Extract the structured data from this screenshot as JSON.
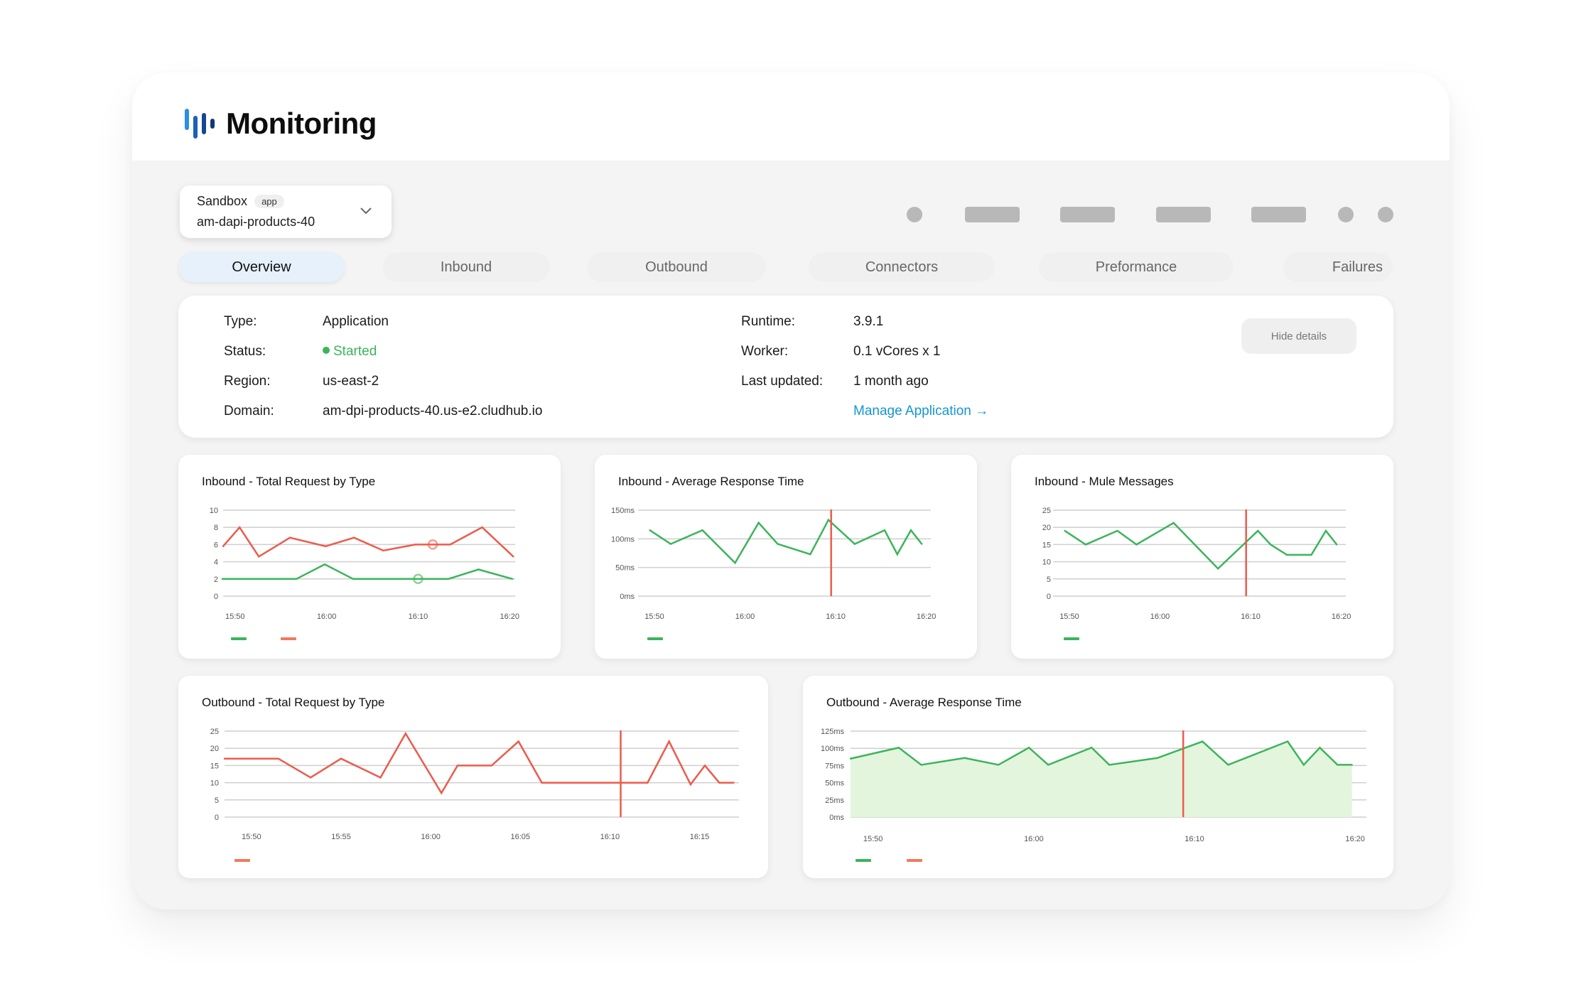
{
  "app": {
    "title": "Monitoring",
    "logo_icon": "bar-chart-logo-icon"
  },
  "selector": {
    "environment": "Sandbox",
    "badge": "app",
    "application": "am-dapi-products-40",
    "icon": "chevron-down-icon"
  },
  "tabs": [
    {
      "label": "Overview",
      "active": true
    },
    {
      "label": "Inbound",
      "active": false
    },
    {
      "label": "Outbound",
      "active": false
    },
    {
      "label": "Connectors",
      "active": false
    },
    {
      "label": "Preformance",
      "active": false
    },
    {
      "label": "Failures",
      "active": false
    }
  ],
  "details": {
    "left": [
      {
        "label": "Type:",
        "value": "Application"
      },
      {
        "label": "Status:",
        "value": "Started"
      },
      {
        "label": "Region:",
        "value": "us-east-2"
      },
      {
        "label": "Domain:",
        "value": "am-dpi-products-40.us-e2.cludhub.io"
      }
    ],
    "right": [
      {
        "label": "Runtime:",
        "value": "3.9.1"
      },
      {
        "label": "Worker:",
        "value": "0.1 vCores x 1"
      },
      {
        "label": "Last updated:",
        "value": "1 month ago"
      }
    ],
    "manage_link": "Manage Application →",
    "hide_button": "Hide details",
    "status_color": "#3cb45a"
  },
  "colors": {
    "green": "#3cb45a",
    "red": "#ec5b4c",
    "green_fill": "#e3f5dd",
    "grid": "#cfcfcf",
    "link": "#1596d2"
  },
  "chart_data": [
    {
      "id": "inbound-total",
      "type": "line",
      "title": "Inbound - Total Request by Type",
      "ylim": [
        0,
        10
      ],
      "yticks": [
        0,
        2,
        4,
        6,
        8,
        10
      ],
      "ytick_labels": [
        "0",
        "2",
        "4",
        "6",
        "8",
        "10"
      ],
      "xlim": [
        -1.3,
        30.6
      ],
      "xticks": [
        0,
        10,
        20,
        30
      ],
      "xtick_labels": [
        "15:50",
        "16:00",
        "16:10",
        "16:20"
      ],
      "series": [
        {
          "name": "",
          "color": "green",
          "x": [
            -1.4,
            6.7,
            9.8,
            12.9,
            20,
            23.3,
            26.6,
            30.3
          ],
          "y": [
            2,
            2,
            3.7,
            2,
            2,
            2,
            3.1,
            2
          ],
          "marker_at": 20
        },
        {
          "name": "",
          "color": "red",
          "x": [
            -1.3,
            0.5,
            2.6,
            6,
            9.9,
            13,
            16.2,
            19.7,
            21.6,
            23.5,
            27,
            30.4
          ],
          "y": [
            5.8,
            8,
            4.6,
            6.8,
            5.8,
            6.8,
            5.3,
            6,
            6,
            6,
            8,
            4.6
          ],
          "marker_at": 21.6
        }
      ],
      "vline": null,
      "legend": [
        "green",
        "red"
      ]
    },
    {
      "id": "inbound-avg-response",
      "type": "line",
      "title": "Inbound - Average Response Time",
      "ylim": [
        0,
        150
      ],
      "yticks": [
        0,
        50,
        100,
        150
      ],
      "ytick_labels": [
        "0ms",
        "50ms",
        "100ms",
        "150ms"
      ],
      "xlim": [
        -1.8,
        30.5
      ],
      "xticks": [
        0,
        10,
        20,
        30
      ],
      "xtick_labels": [
        "15:50",
        "16:00",
        "16:10",
        "16:20"
      ],
      "series": [
        {
          "name": "",
          "color": "green",
          "x": [
            -0.5,
            1.8,
            5.3,
            8.9,
            11.5,
            13.6,
            17.2,
            19.2,
            22.1,
            25.4,
            26.8,
            28.3,
            29.5
          ],
          "y": [
            115,
            91,
            115,
            58,
            128,
            91,
            73,
            133,
            91,
            115,
            73,
            115,
            91
          ]
        }
      ],
      "vline": 19.5,
      "legend": [
        "green"
      ]
    },
    {
      "id": "inbound-mule-messages",
      "type": "line",
      "title": "Inbound - Mule Messages",
      "ylim": [
        0,
        25
      ],
      "yticks": [
        0,
        5,
        10,
        15,
        20,
        25
      ],
      "ytick_labels": [
        "0",
        "5",
        "10",
        "15",
        "20",
        "25"
      ],
      "xlim": [
        -1.8,
        30.5
      ],
      "xticks": [
        0,
        10,
        20,
        30
      ],
      "xtick_labels": [
        "15:50",
        "16:00",
        "16:10",
        "16:20"
      ],
      "series": [
        {
          "name": "",
          "color": "green",
          "x": [
            -0.5,
            1.8,
            5.3,
            7.4,
            11.5,
            16.4,
            19.4,
            20.8,
            22.2,
            24,
            26.7,
            28.3,
            29.5
          ],
          "y": [
            19,
            15,
            19,
            15,
            21.3,
            8,
            15.5,
            19,
            15,
            12,
            12,
            19,
            15
          ]
        }
      ],
      "vline": 19.5,
      "legend": [
        "green"
      ]
    },
    {
      "id": "outbound-total",
      "type": "line",
      "title": "Outbound - Total Request by Type",
      "ylim": [
        0,
        25
      ],
      "yticks": [
        0,
        5,
        10,
        15,
        20,
        25
      ],
      "ytick_labels": [
        "0",
        "5",
        "10",
        "15",
        "20",
        "25"
      ],
      "xlim": [
        -1.5,
        27.2
      ],
      "xticks": [
        0,
        5,
        10,
        15,
        20,
        25
      ],
      "xtick_labels": [
        "15:50",
        "15:55",
        "16:00",
        "16:05",
        "16:10",
        "16:15"
      ],
      "series": [
        {
          "name": "",
          "color": "red",
          "x": [
            -1.5,
            1.5,
            3.3,
            5,
            7.2,
            8.6,
            10.6,
            11.5,
            13.4,
            14.9,
            16.2,
            22.1,
            23.3,
            24.5,
            25.3,
            26.1,
            26.9
          ],
          "y": [
            17,
            17,
            11.5,
            17,
            11.5,
            24.3,
            7,
            15,
            15,
            22,
            10,
            10,
            22,
            9.5,
            15,
            10,
            10
          ]
        }
      ],
      "vline": 20.6,
      "legend": [
        "red"
      ]
    },
    {
      "id": "outbound-avg-response",
      "type": "area",
      "title": "Outbound - Average Response Time",
      "ylim": [
        0,
        125
      ],
      "yticks": [
        0,
        25,
        50,
        75,
        100,
        125
      ],
      "ytick_labels": [
        "0ms",
        "25ms",
        "50ms",
        "75ms",
        "100ms",
        "125ms"
      ],
      "xlim": [
        -1.4,
        30.7
      ],
      "xticks": [
        0,
        10,
        20,
        30
      ],
      "xtick_labels": [
        "15:50",
        "16:00",
        "16:10",
        "16:20"
      ],
      "series": [
        {
          "name": "",
          "color": "green",
          "x": [
            -1.4,
            1.6,
            3,
            5.7,
            7.8,
            9.7,
            10.9,
            13.6,
            14.7,
            17.7,
            20.5,
            22.1,
            25.8,
            26.8,
            27.8,
            28.9,
            29.8
          ],
          "y": [
            85,
            101,
            76,
            86,
            76,
            101,
            76,
            101,
            76,
            86,
            110,
            76,
            110,
            76,
            101,
            76,
            76
          ]
        }
      ],
      "vline": 19.3,
      "legend": [
        "green",
        "red"
      ]
    }
  ]
}
